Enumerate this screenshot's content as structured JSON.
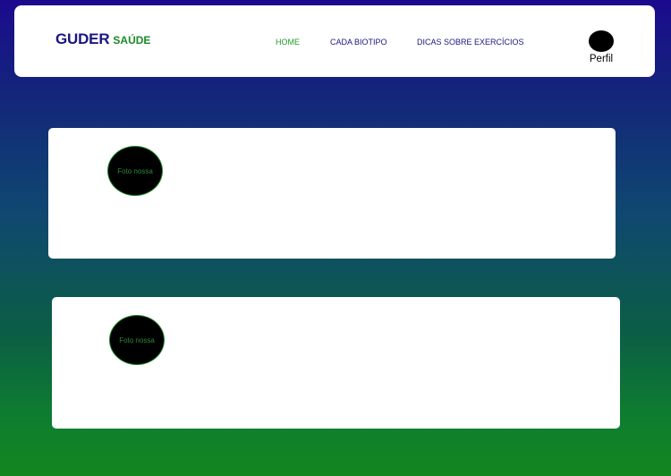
{
  "brand": {
    "main": "GUDER",
    "sub": "SAÚDE"
  },
  "nav": {
    "items": [
      {
        "label": "HOME",
        "active": true
      },
      {
        "label": "CADA BIOTIPO",
        "active": false
      },
      {
        "label": "DICAS SOBRE EXERCÍCIOS",
        "active": false
      }
    ]
  },
  "profile": {
    "label": "Perfil",
    "avatar_icon": "user-avatar-icon"
  },
  "cards": [
    {
      "photo_alt": "Foto nossa"
    },
    {
      "photo_alt": "Foto nossa"
    }
  ],
  "colors": {
    "brand_primary": "#1a1580",
    "brand_secondary": "#1a8a2a",
    "active_nav": "#1f9a2a",
    "gradient_top": "#1b0a8e",
    "gradient_bottom": "#13861f"
  }
}
